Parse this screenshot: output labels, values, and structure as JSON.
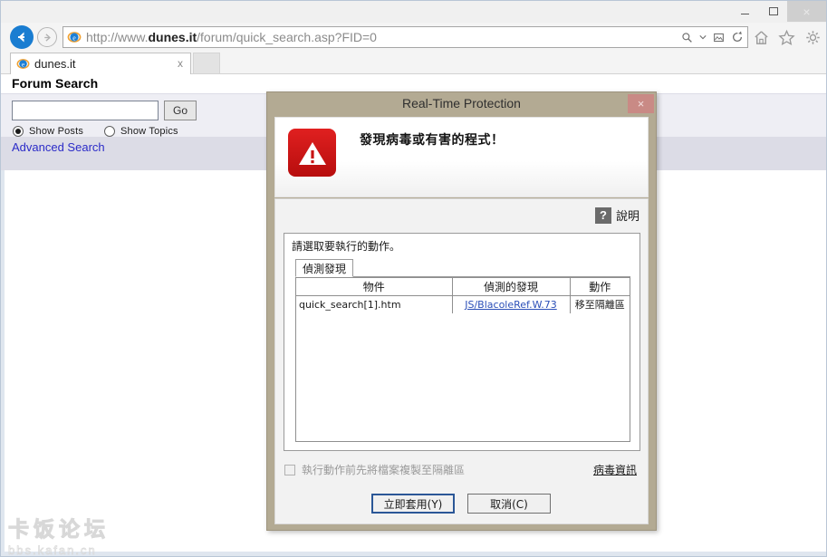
{
  "browser": {
    "window_controls": {
      "minimize": "minimize-icon",
      "maximize": "maximize-icon",
      "close": "×"
    },
    "back_icon": "back-arrow-icon",
    "forward_icon": "forward-arrow-icon",
    "address": {
      "prefix": "http://www.",
      "domain": "dunes.it",
      "suffix": "/forum/quick_search.asp?FID=0",
      "full": "http://www.dunes.it/forum/quick_search.asp?FID=0"
    },
    "address_icons": {
      "search": "search-icon",
      "dropdown": "chevron-down-icon",
      "compat": "compatibility-view-icon",
      "refresh": "refresh-icon"
    },
    "toolbar_icons": {
      "home": "home-icon",
      "favorites": "star-icon",
      "settings": "gear-icon"
    },
    "tab": {
      "label": "dunes.it",
      "close": "x",
      "favicon": "ie-favicon"
    }
  },
  "page": {
    "title": "Forum Search",
    "search_value": "",
    "search_placeholder": "",
    "go_label": "Go",
    "radios": [
      {
        "label": "Show Posts",
        "checked": true
      },
      {
        "label": "Show Topics",
        "checked": false
      }
    ],
    "advanced_search": "Advanced Search",
    "watermark": {
      "cn": "卡饭论坛",
      "url": "bbs.kafan.cn"
    }
  },
  "dialog": {
    "title": "Real-Time Protection",
    "close_label": "×",
    "warning_icon": "warning-triangle-icon",
    "heading": "發現病毒或有害的程式！",
    "help_icon_char": "?",
    "help_label": "說明",
    "action_prompt": "請選取要執行的動作。",
    "tab_label": "偵測發現",
    "table": {
      "headers": [
        "物件",
        "偵測的發現",
        "動作"
      ],
      "rows": [
        {
          "object": "quick_search[1].htm",
          "detection": "JS/BlacoleRef.W.73",
          "action": "移至隔離區"
        }
      ]
    },
    "copy_checkbox_label": "執行動作前先將檔案複製至隔離區",
    "copy_checkbox_checked": false,
    "virus_info_link": "病毒資訊",
    "apply_label": "立即套用(Y)",
    "cancel_label": "取消(C)"
  },
  "colors": {
    "dialog_frame": "#b3aa93",
    "dialog_close": "#c98a85",
    "warning_red": "#d01414",
    "link_blue": "#2b4fb8",
    "accent_blue": "#1a7dd1",
    "page_band": "#dcdce6"
  }
}
